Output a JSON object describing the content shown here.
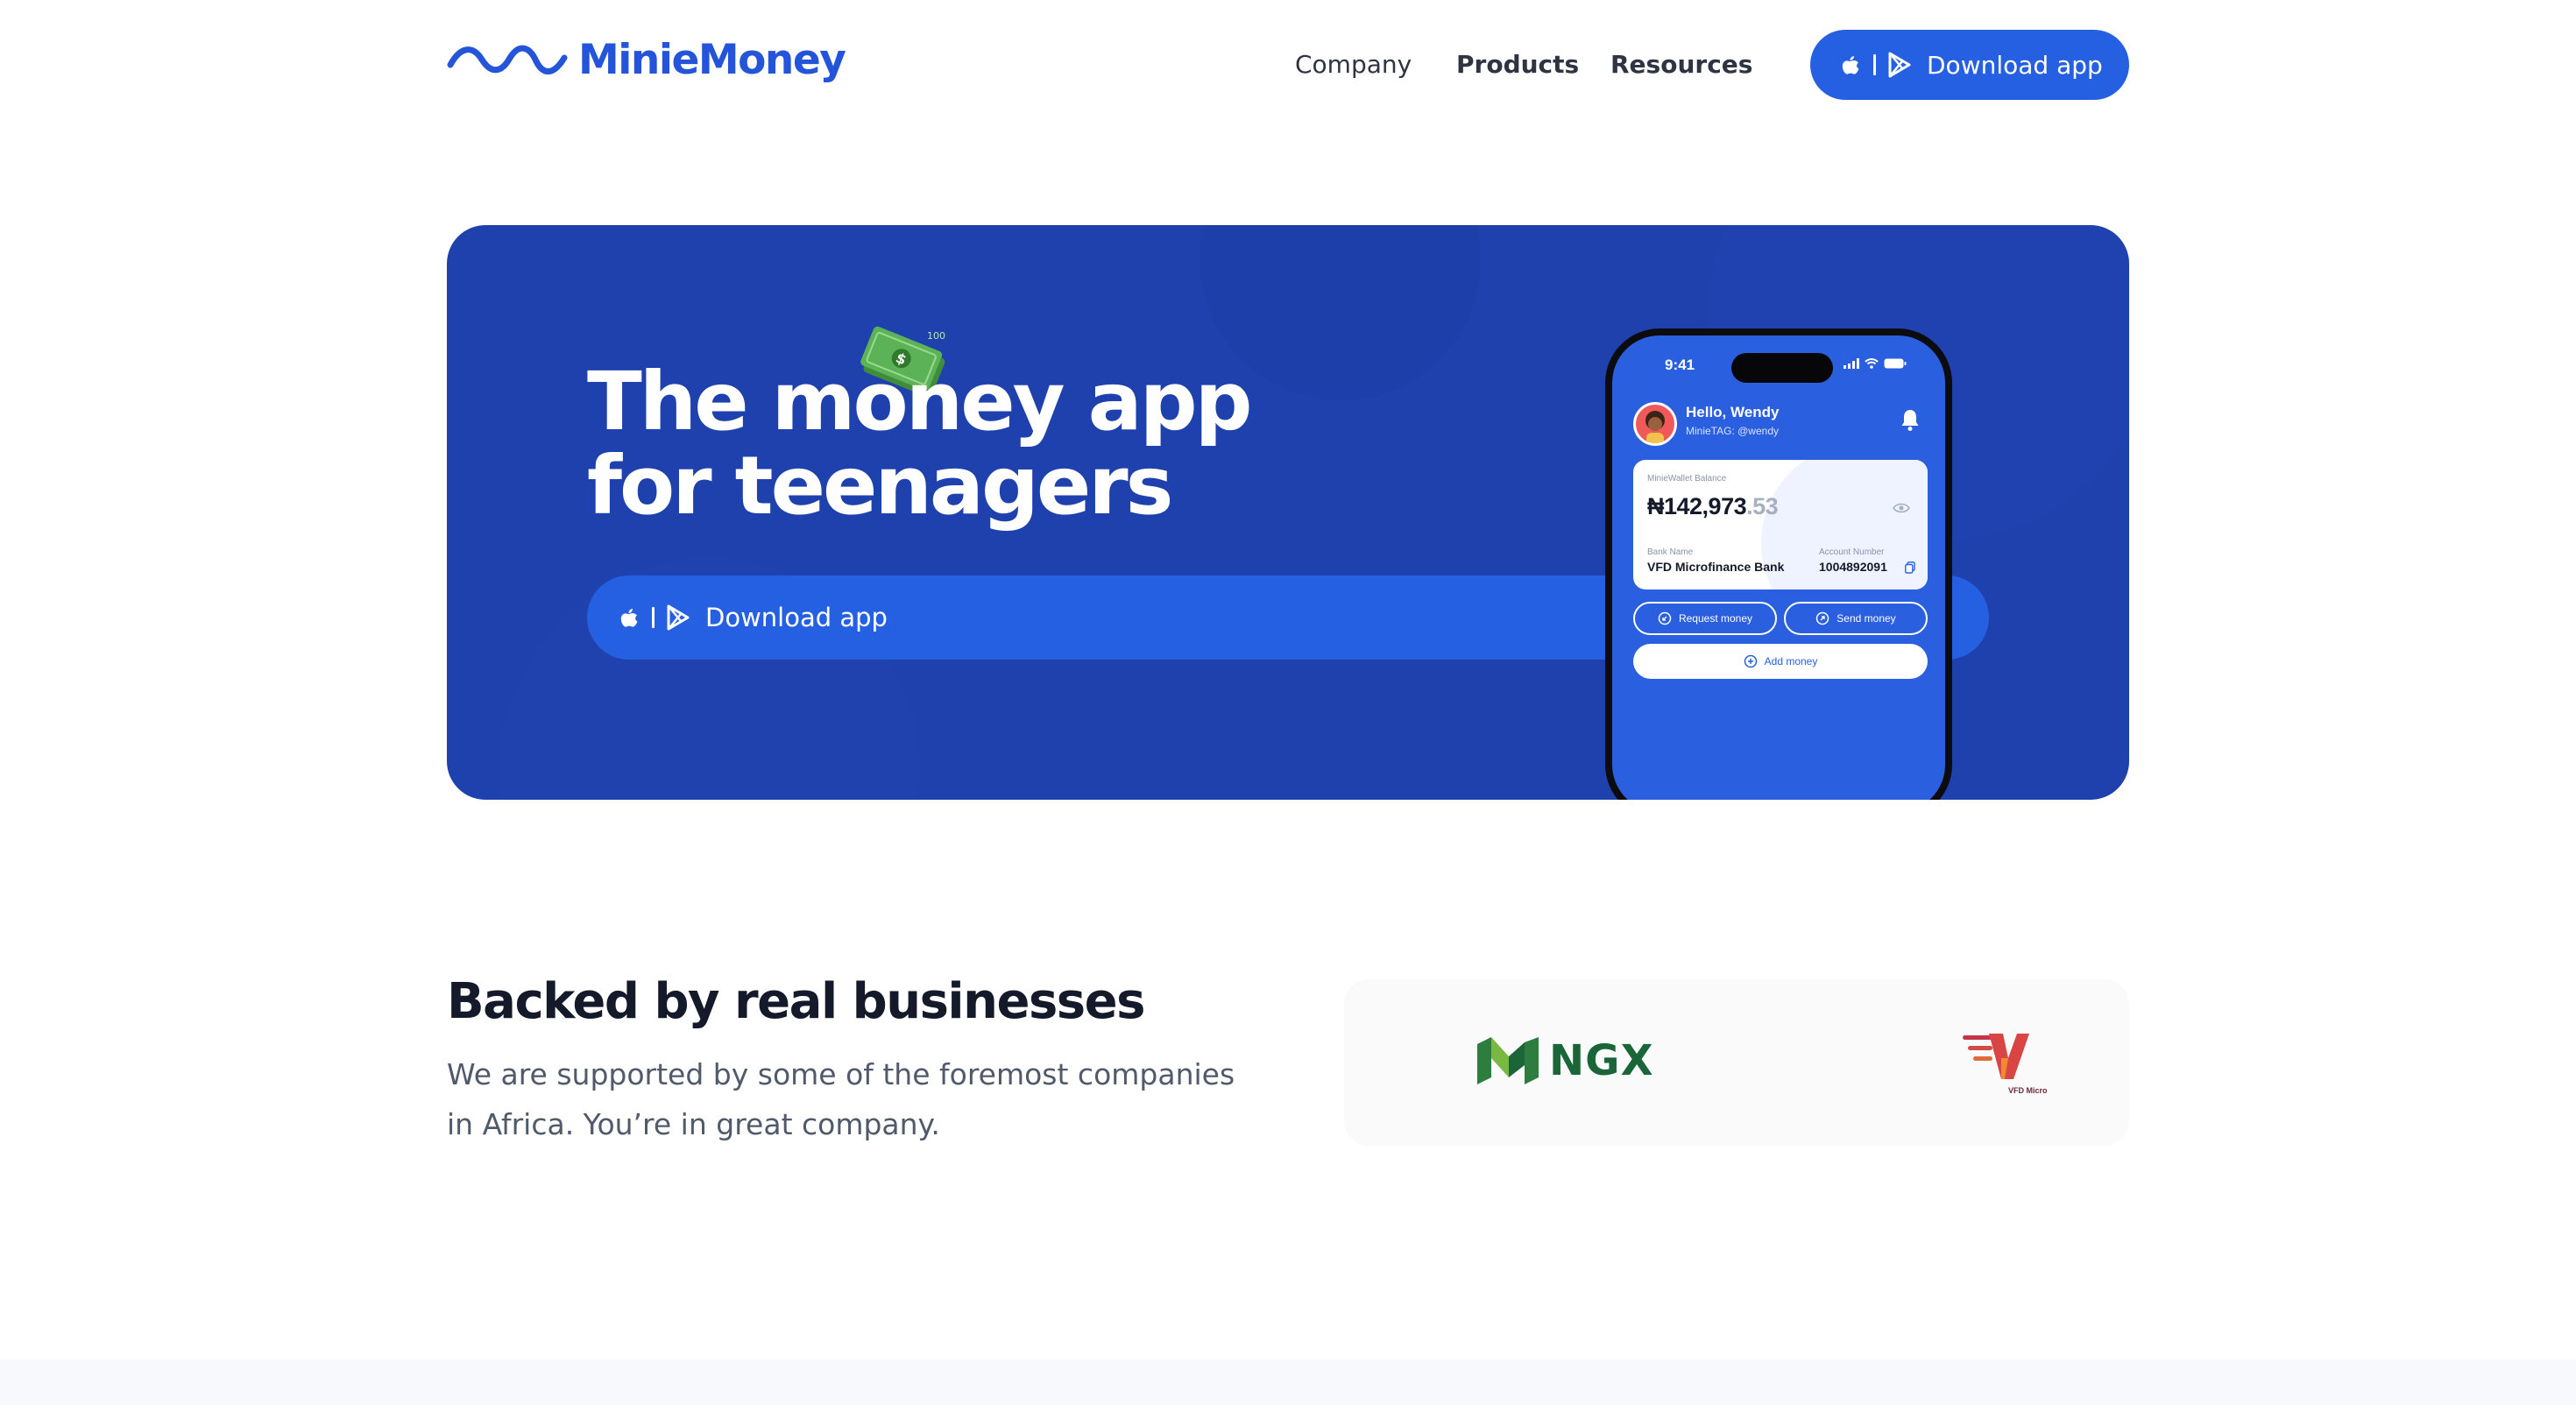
{
  "brand": {
    "name": "MinieMoney",
    "color": "#2354d9"
  },
  "nav": {
    "company": "Company",
    "products": "Products",
    "resources": "Resources"
  },
  "header_cta": {
    "label": "Download app",
    "separator": "|"
  },
  "hero": {
    "title": "The money app\nfor teenagers",
    "cta_label": "Download app",
    "cta_separator": "|",
    "background_color": "#1e41ad",
    "cta_color": "#2660e2"
  },
  "phone": {
    "time": "9:41",
    "greeting": "Hello, Wendy",
    "tag": "MinieTAG: @wendy",
    "wallet_label": "MinieWallet Balance",
    "balance_main": "₦142,973",
    "balance_decimal": ".53",
    "bank_name_label": "Bank Name",
    "bank_name": "VFD Microfinance Bank",
    "account_number_label": "Account Number",
    "account_number": "1004892091",
    "request_money": "Request money",
    "send_money": "Send money",
    "add_money": "Add money"
  },
  "backed": {
    "title": "Backed by real businesses",
    "subtitle": "We are supported by some of the foremost companies in Africa. You’re in great company."
  },
  "partners": {
    "ngx": "NGX",
    "vfd": "VFD Micro"
  }
}
